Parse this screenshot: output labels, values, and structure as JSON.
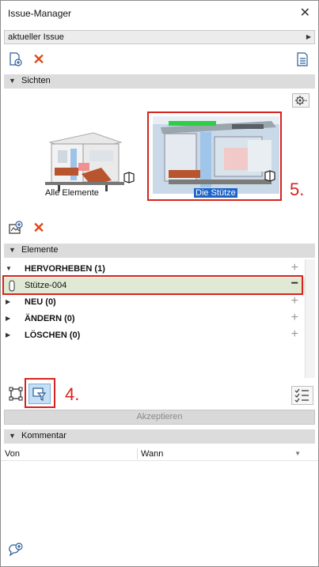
{
  "window": {
    "title": "Issue-Manager",
    "close_glyph": "✕"
  },
  "issue_selector": {
    "value": "aktueller Issue",
    "arrow_glyph": "▶"
  },
  "toolbar_top": {
    "new_issue_icon": "new-issue-icon",
    "delete_icon": "delete-icon",
    "delete_glyph": "✕",
    "list_icon": "issue-list-icon"
  },
  "sichten": {
    "header": "Sichten",
    "collapse_glyph": "▼",
    "settings_icon": "gear-icon",
    "views": [
      {
        "caption": "Alle Elemente",
        "selected": false
      },
      {
        "caption": "Die Stütze",
        "selected": true
      }
    ]
  },
  "annotations": {
    "step5": "5.",
    "step4": "4."
  },
  "toolbar_mid": {
    "add_view_icon": "add-view-icon",
    "delete_glyph": "✕"
  },
  "elemente": {
    "header": "Elemente",
    "collapse_glyph": "▼",
    "groups": [
      {
        "label": "HERVORHEBEN (1)",
        "expanded": true,
        "action": "+"
      },
      {
        "label": "Stütze-004",
        "is_item": true,
        "action": "−"
      },
      {
        "label": "NEU (0)",
        "expanded": false,
        "action": "+"
      },
      {
        "label": "ÄNDERN (0)",
        "expanded": false,
        "action": "+"
      },
      {
        "label": "LÖSCHEN (0)",
        "expanded": false,
        "action": "+"
      }
    ],
    "expanded_glyph": "▼",
    "collapsed_glyph": "▶"
  },
  "toolbar_bottom": {
    "select_frame_icon": "selection-frame-icon",
    "filter_icon": "filter-selection-icon",
    "checklist_icon": "checklist-icon"
  },
  "accept_button": {
    "label": "Akzeptieren",
    "enabled": false
  },
  "kommentar": {
    "header": "Kommentar",
    "collapse_glyph": "▼",
    "columns": [
      "Von",
      "Wann"
    ],
    "sort_glyph": "▼"
  },
  "footer": {
    "add_comment_icon": "add-comment-icon"
  },
  "colors": {
    "accent_red": "#d6231f",
    "delete_orange": "#e04a1a",
    "selection_blue": "#1e64c8",
    "highlight_row": "#dfe9d3",
    "filter_btn_bg": "#c5dff5"
  }
}
